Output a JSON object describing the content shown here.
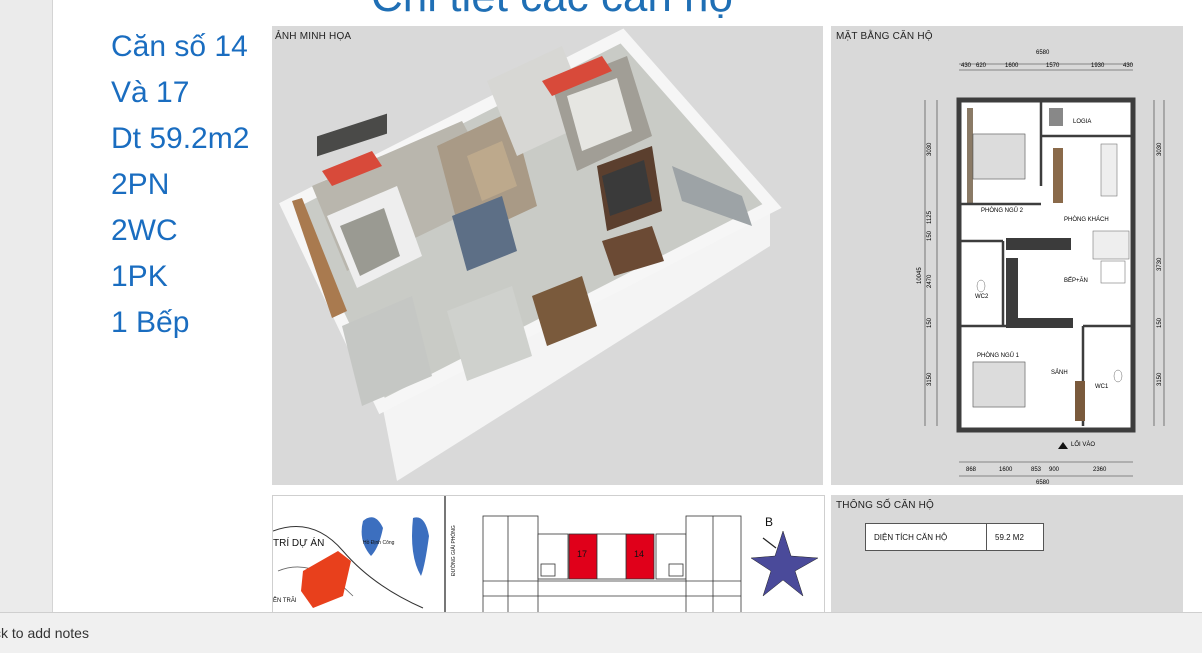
{
  "slide": {
    "title": "Chi tiết các căn hộ",
    "specs": [
      "Căn số 14",
      "Và 17",
      "Dt 59.2m2",
      "2PN",
      "2WC",
      "1PK",
      "1 Bếp"
    ]
  },
  "render_panel": {
    "label": "ẢNH MINH HỌA"
  },
  "floorplan_panel": {
    "label": "MẶT BẰNG CĂN HỘ",
    "rooms": {
      "logia": "LOGIA",
      "bedroom2": "PHÒNG NGỦ 2",
      "living": "PHÒNG KHÁCH",
      "kitchen": "BẾP+ĂN",
      "wc2": "WC2",
      "bedroom1": "PHÒNG NGỦ 1",
      "lobby": "SẢNH",
      "wc1": "WC1",
      "entry": "LỐI VÀO"
    },
    "dims": {
      "top_total": "6580",
      "top_segments": [
        "430",
        "620",
        "1600",
        "1570",
        "1930",
        "430"
      ],
      "bottom_segments": [
        "868",
        "1600",
        "853",
        "900",
        "2360"
      ],
      "bottom_total": "6580",
      "left": [
        "3030",
        "1125",
        "150",
        "2470",
        "150",
        "3150"
      ],
      "left_total": "10045",
      "right": [
        "3030",
        "3730",
        "150",
        "3150"
      ]
    }
  },
  "specs_panel": {
    "label": "THÔNG SỐ CĂN HỘ",
    "area_label": "DIỆN TÍCH CĂN HỘ",
    "area_value": "59.2 M2"
  },
  "location_panel": {
    "project_label": "TRÍ DỰ ÁN",
    "lake_label": "Hồ Định Công",
    "road_label": "ĐƯỜNG GIẢI PHÓNG",
    "road2_label": "ỄN TRÃI",
    "unit_a": "17",
    "unit_b": "14",
    "compass_letter": "B"
  },
  "notes": {
    "placeholder": "ck to add notes"
  },
  "colors": {
    "title_blue": "#1a6dc0",
    "unit_red": "#e0001a",
    "project_red": "#e8401c",
    "panel_gray": "#d9d9d9"
  }
}
